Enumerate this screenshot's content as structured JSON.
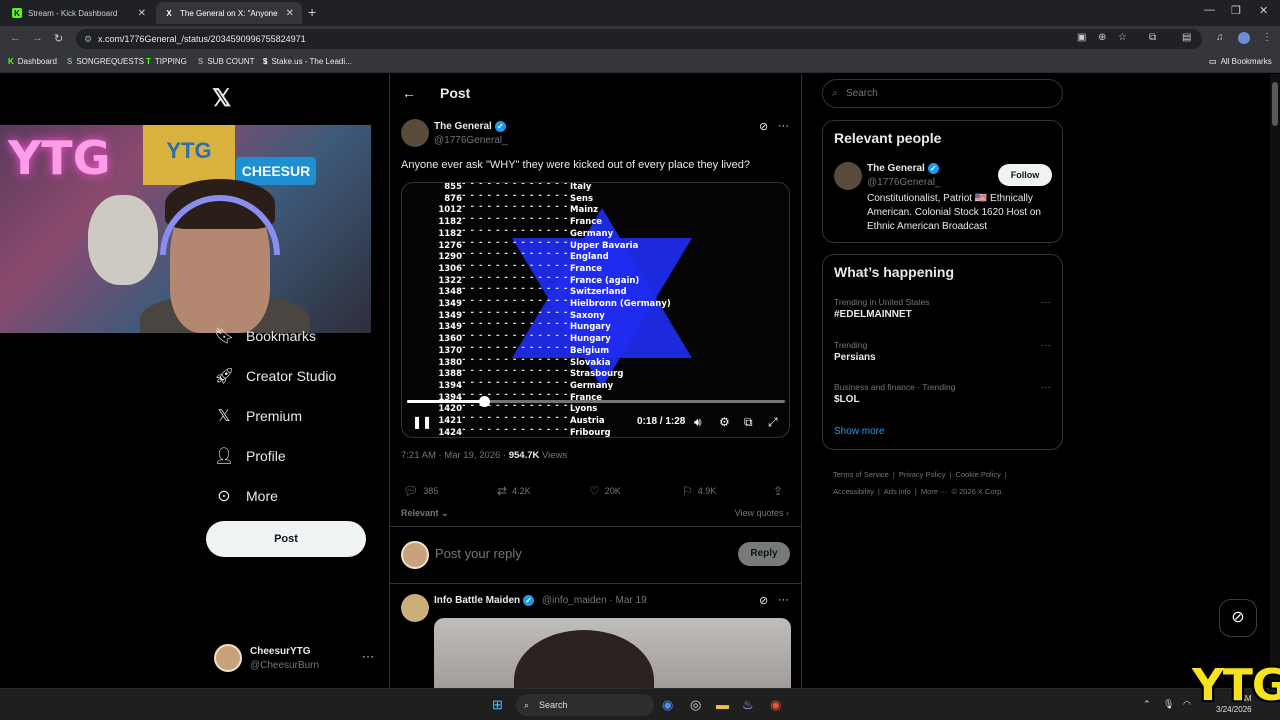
{
  "browser": {
    "tabs": [
      {
        "label": "Stream - Kick Dashboard",
        "favicon": "K"
      },
      {
        "label": "The General on X: \"Anyone",
        "favicon": "X"
      }
    ],
    "url": "x.com/1776General_/status/2034590996755824971",
    "bookmarks": [
      {
        "label": "Dashboard",
        "icon": "K"
      },
      {
        "label": "SONGREQUESTS",
        "icon": "S"
      },
      {
        "label": "TIPPING",
        "icon": "T"
      },
      {
        "label": "SUB COUNT",
        "icon": "S"
      },
      {
        "label": "Stake.us - The Leadi...",
        "icon": "$"
      }
    ],
    "all_bookmarks": "All Bookmarks"
  },
  "webcam": {
    "neon_text": "YTG",
    "flag_text": "YTG",
    "sign_text": "CHEESUR"
  },
  "sidebar": {
    "items": [
      {
        "label": "Bookmarks",
        "icon": "bookmark-icon"
      },
      {
        "label": "Creator Studio",
        "icon": "rocket-icon"
      },
      {
        "label": "Premium",
        "icon": "x-icon"
      },
      {
        "label": "Profile",
        "icon": "person-icon"
      },
      {
        "label": "More",
        "icon": "more-circle-icon"
      }
    ],
    "post_button": "Post",
    "account": {
      "name": "CheesurYTG",
      "handle": "@CheesurBurn"
    }
  },
  "main": {
    "title": "Post",
    "author": {
      "name": "The General",
      "handle": "@1776General_"
    },
    "text": "Anyone ever ask \"WHY\" they were kicked out of every place they lived?",
    "video": {
      "rows": [
        {
          "year": "855",
          "place": "Italy"
        },
        {
          "year": "876",
          "place": "Sens"
        },
        {
          "year": "1012",
          "place": "Mainz"
        },
        {
          "year": "1182",
          "place": "France"
        },
        {
          "year": "1182",
          "place": "Germany"
        },
        {
          "year": "1276",
          "place": "Upper Bavaria"
        },
        {
          "year": "1290",
          "place": "England"
        },
        {
          "year": "1306",
          "place": "France"
        },
        {
          "year": "1322",
          "place": "France (again)"
        },
        {
          "year": "1348",
          "place": "Switzerland"
        },
        {
          "year": "1349",
          "place": "Hielbronn (Germany)"
        },
        {
          "year": "1349",
          "place": "Saxony"
        },
        {
          "year": "1349",
          "place": "Hungary"
        },
        {
          "year": "1360",
          "place": "Hungary"
        },
        {
          "year": "1370",
          "place": "Belgium"
        },
        {
          "year": "1380",
          "place": "Slovakia"
        },
        {
          "year": "1388",
          "place": "Strasbourg"
        },
        {
          "year": "1394",
          "place": "Germany"
        },
        {
          "year": "1394",
          "place": "France"
        },
        {
          "year": "1420",
          "place": "Lyons"
        },
        {
          "year": "1421",
          "place": "Austria"
        },
        {
          "year": "1424",
          "place": "Fribourg"
        }
      ],
      "time": "0:18 / 1:28",
      "progress": 0.2045
    },
    "timestamp": "7:21 AM · Mar 19, 2026 · ",
    "views_count": "954.7K",
    "views_label": " Views",
    "actions": {
      "replies": "385",
      "reposts": "4.2K",
      "likes": "20K",
      "bookmarks": "4.9K"
    },
    "sort": "Relevant",
    "view_quotes": "View quotes",
    "reply_placeholder": "Post your reply",
    "reply_button": "Reply",
    "reply_post": {
      "name": "Info Battle Maiden",
      "handle": "@info_maiden · Mar 19"
    }
  },
  "right": {
    "search_placeholder": "Search",
    "relevant_people": {
      "title": "Relevant people",
      "name": "The General",
      "handle": "@1776General_",
      "follow": "Follow",
      "bio": "Constitutionalist, Patriot 🇺🇸 Ethnically American. Colonial Stock 1620 Host on Ethnic American Broadcast"
    },
    "happening": {
      "title": "What’s happening",
      "trends": [
        {
          "context": "Trending in United States",
          "name": "#EDELMAINNET"
        },
        {
          "context": "Trending",
          "name": "Persians"
        },
        {
          "context": "Business and finance · Trending",
          "name": "$LOL"
        }
      ],
      "show_more": "Show more"
    },
    "footer": [
      "Terms of Service",
      "|",
      "Privacy Policy",
      "|",
      "Cookie Policy",
      "|",
      "Accessibility",
      "|",
      "Ads info",
      "|",
      "More ···",
      "© 2026 X Corp."
    ]
  },
  "taskbar": {
    "search": "Search",
    "time": "9 AM",
    "date": "3/24/2026"
  },
  "overlay": {
    "logo": "YTG"
  }
}
